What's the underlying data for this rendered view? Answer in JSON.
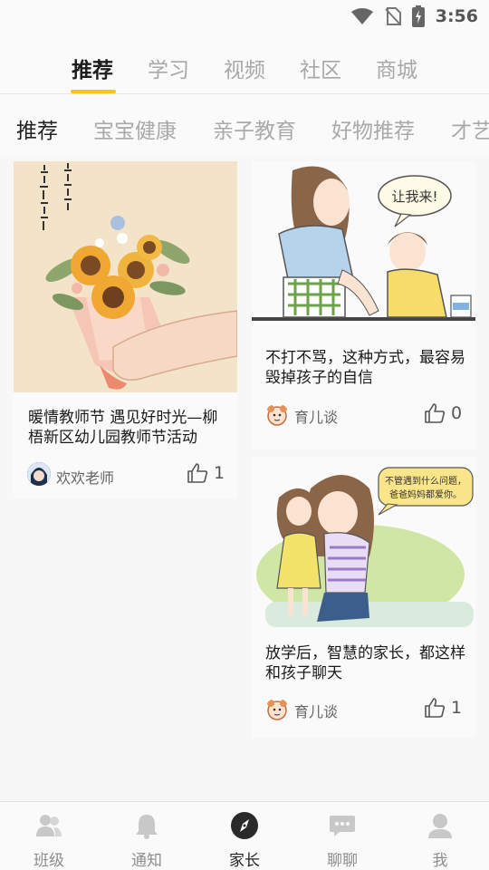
{
  "status_bar": {
    "time": "3:56",
    "icons": [
      "wifi-icon",
      "no-sim-icon",
      "battery-icon"
    ]
  },
  "top_tabs": [
    {
      "label": "推荐",
      "active": true
    },
    {
      "label": "学习",
      "active": false
    },
    {
      "label": "视频",
      "active": false
    },
    {
      "label": "社区",
      "active": false
    },
    {
      "label": "商城",
      "active": false
    }
  ],
  "sub_tabs": [
    {
      "label": "推荐",
      "active": true
    },
    {
      "label": "宝宝健康",
      "active": false
    },
    {
      "label": "亲子教育",
      "active": false
    },
    {
      "label": "好物推荐",
      "active": false
    },
    {
      "label": "才艺",
      "active": false
    }
  ],
  "feed": [
    {
      "image": "sunflower-bouquet-illustration",
      "image_text": "这个教师节谢谢每一位老师",
      "title": "暖情教师节 遇见好时光—柳梧新区幼儿园教师节活动",
      "author": "欢欢老师",
      "likes": "1"
    },
    {
      "image": "mother-child-cooking-illustration",
      "image_text": "让我来!",
      "title": "不打不骂，这种方式，最容易毁掉孩子的自信",
      "author": "育儿谈",
      "likes": "0"
    },
    {
      "image": "mother-hugging-child-illustration",
      "image_text": "不管遇到什么问题，爸爸妈妈都爱你。",
      "title": "放学后，智慧的家长，都这样和孩子聊天",
      "author": "育儿谈",
      "likes": "1"
    }
  ],
  "bottom_nav": [
    {
      "label": "班级",
      "icon": "class-people-icon",
      "active": false
    },
    {
      "label": "通知",
      "icon": "bell-icon",
      "active": false
    },
    {
      "label": "家长",
      "icon": "compass-icon",
      "active": true
    },
    {
      "label": "聊聊",
      "icon": "chat-icon",
      "active": false
    },
    {
      "label": "我",
      "icon": "person-icon",
      "active": false
    }
  ],
  "colors": {
    "accent": "#f5c518",
    "active_text": "#1d1d1d",
    "inactive_text": "#a8a8a8"
  }
}
